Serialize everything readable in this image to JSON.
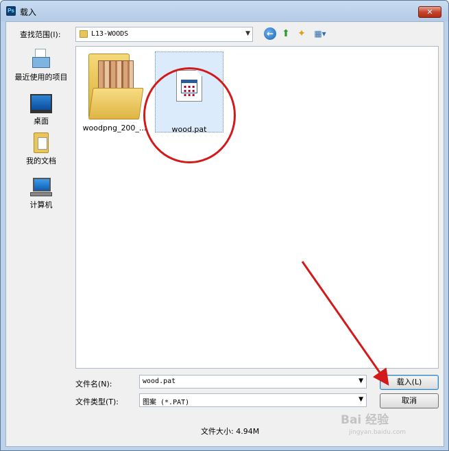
{
  "window": {
    "title": "载入",
    "app_icon": "Ps",
    "close_symbol": "✕"
  },
  "toolbar": {
    "look_in_label": "查找范围(I):",
    "look_in_value": "L13-WOODS",
    "icons": [
      "back-icon",
      "up-folder-icon",
      "new-folder-icon",
      "views-menu-icon"
    ]
  },
  "places": [
    {
      "label": "最近使用的项目",
      "icon": "recent-items-icon"
    },
    {
      "label": "桌面",
      "icon": "desktop-icon"
    },
    {
      "label": "我的文档",
      "icon": "my-documents-icon"
    },
    {
      "label": "计算机",
      "icon": "computer-icon"
    }
  ],
  "files": [
    {
      "name": "woodpng_200_...",
      "type": "folder",
      "selected": false
    },
    {
      "name": "wood.pat",
      "type": "pattern-file",
      "selected": true
    }
  ],
  "form": {
    "filename_label": "文件名(N):",
    "filename_value": "wood.pat",
    "filetype_label": "文件类型(T):",
    "filetype_value": "图案 (*.PAT)",
    "load_button": "载入(L)",
    "cancel_button": "取消",
    "file_size": "文件大小: 4.94M"
  },
  "watermark": {
    "brand": "Bai 经验",
    "url": "jingyan.baidu.com"
  },
  "colors": {
    "annotation_red": "#d21a1a",
    "selection_bg": "#dcebfb"
  }
}
